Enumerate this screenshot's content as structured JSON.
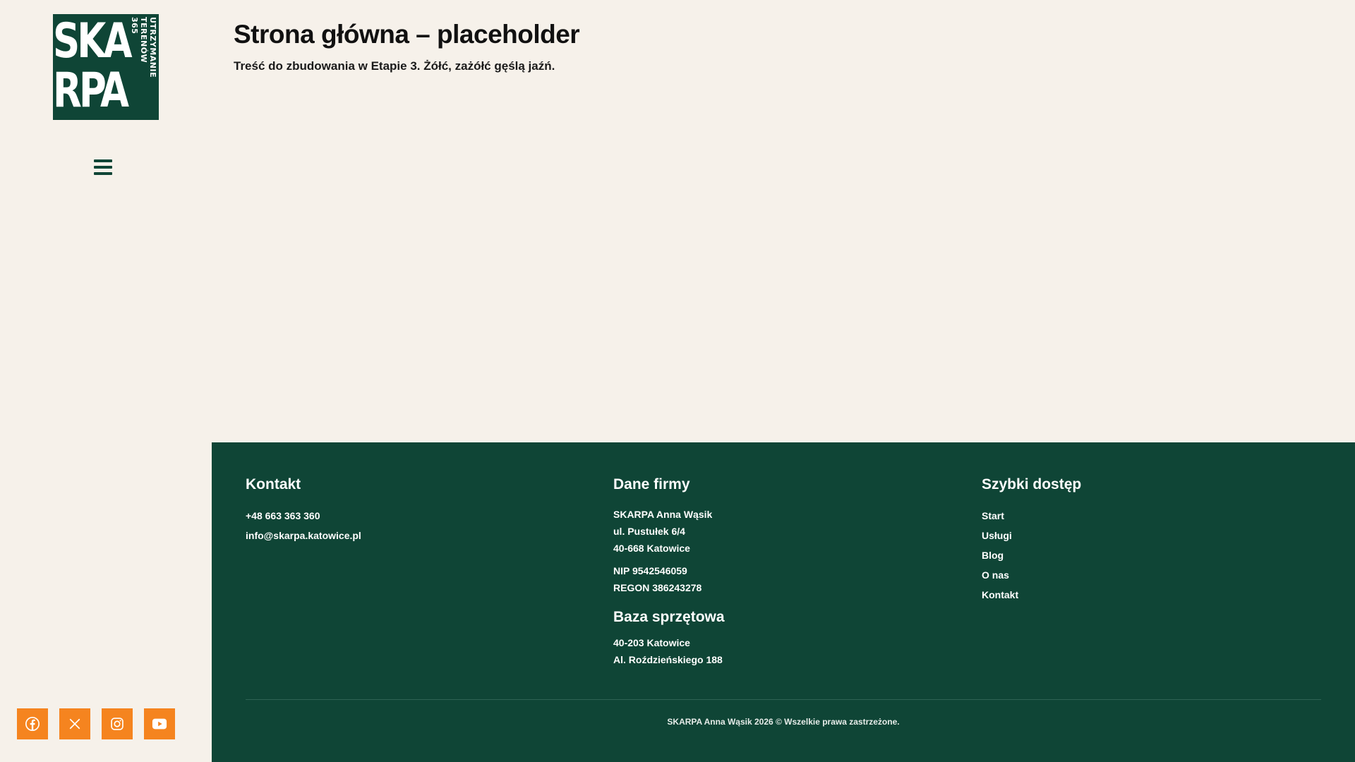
{
  "sidebar": {
    "logo": {
      "big_text": "SKA\nRPA",
      "vertical_line1": "UTRZYMANIE TERENÓW",
      "vertical_line2": "365",
      "bg_color": "#0f4536"
    },
    "menu_icon": "hamburger-icon",
    "socials": [
      {
        "icon": "facebook-icon"
      },
      {
        "icon": "x-twitter-icon"
      },
      {
        "icon": "instagram-icon"
      },
      {
        "icon": "youtube-icon"
      }
    ],
    "social_color": "#f5841f"
  },
  "main": {
    "title": "Strona główna – placeholder",
    "text": "Treść do zbudowania w Etapie 3. Żółć, zażółć gęślą jaźń."
  },
  "footer": {
    "bg_color": "#0f4536",
    "contact": {
      "heading": "Kontakt",
      "phone": "+48 663 363 360",
      "email": "info@skarpa.katowice.pl"
    },
    "company": {
      "heading": "Dane firmy",
      "name": "SKARPA Anna Wąsik",
      "street": "ul. Pustułek 6/4",
      "city": "40-668 Katowice",
      "nip": "NIP 9542546059",
      "regon": "REGON 386243278",
      "base_heading": "Baza sprzętowa",
      "base_city": "40-203 Katowice",
      "base_street": "Al. Roździeńskiego 188"
    },
    "quick": {
      "heading": "Szybki dostęp",
      "links": [
        "Start",
        "Usługi",
        "Blog",
        "O nas",
        "Kontakt"
      ]
    },
    "copyright": "SKARPA Anna Wąsik 2026 © Wszelkie prawa zastrzeżone."
  }
}
